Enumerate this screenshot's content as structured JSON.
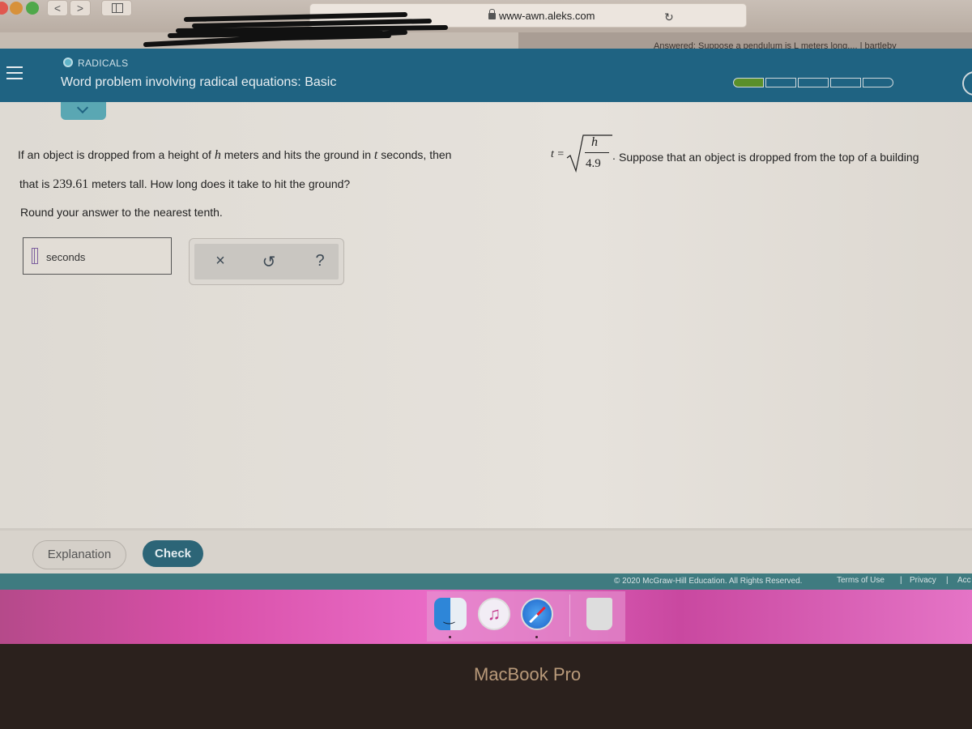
{
  "browser": {
    "url": "www-awn.aleks.com",
    "active_tab_title": "Answered: Suppose a pendulum is L meters long.... | bartleby",
    "back_label": "<",
    "forward_label": ">",
    "reload_icon": "↻"
  },
  "header": {
    "topic_label": "RADICALS",
    "title": "Word problem involving radical equations: Basic",
    "progress": {
      "completed_segments": 1,
      "total_segments": 5
    }
  },
  "problem": {
    "line1_part1": "If an object is dropped from a height of ",
    "var_h": "h",
    "line1_part2": " meters and hits the ground in ",
    "var_t": "t",
    "line1_part3": " seconds, then ",
    "equals": "t =",
    "frac_numerator": "h",
    "frac_denominator": "4.9",
    "period": ".",
    "line1_part4": "Suppose that an object is dropped from the top of a building",
    "line2_part1": "that is ",
    "height_value": "239.61",
    "line2_part2": " meters tall. How long does it take to hit the ground?",
    "line3": "Round your answer to the nearest tenth."
  },
  "answer": {
    "value": "",
    "unit": "seconds"
  },
  "tools": {
    "clear_icon": "×",
    "undo_icon": "↺",
    "help_icon": "?"
  },
  "actions": {
    "explanation_label": "Explanation",
    "check_label": "Check"
  },
  "footer": {
    "copyright": "© 2020 McGraw-Hill Education. All Rights Reserved.",
    "terms": "Terms of Use",
    "separator": "|",
    "privacy": "Privacy",
    "accessibility": "Acc"
  },
  "device": {
    "label": "MacBook Pro",
    "music_glyph": "♫"
  }
}
